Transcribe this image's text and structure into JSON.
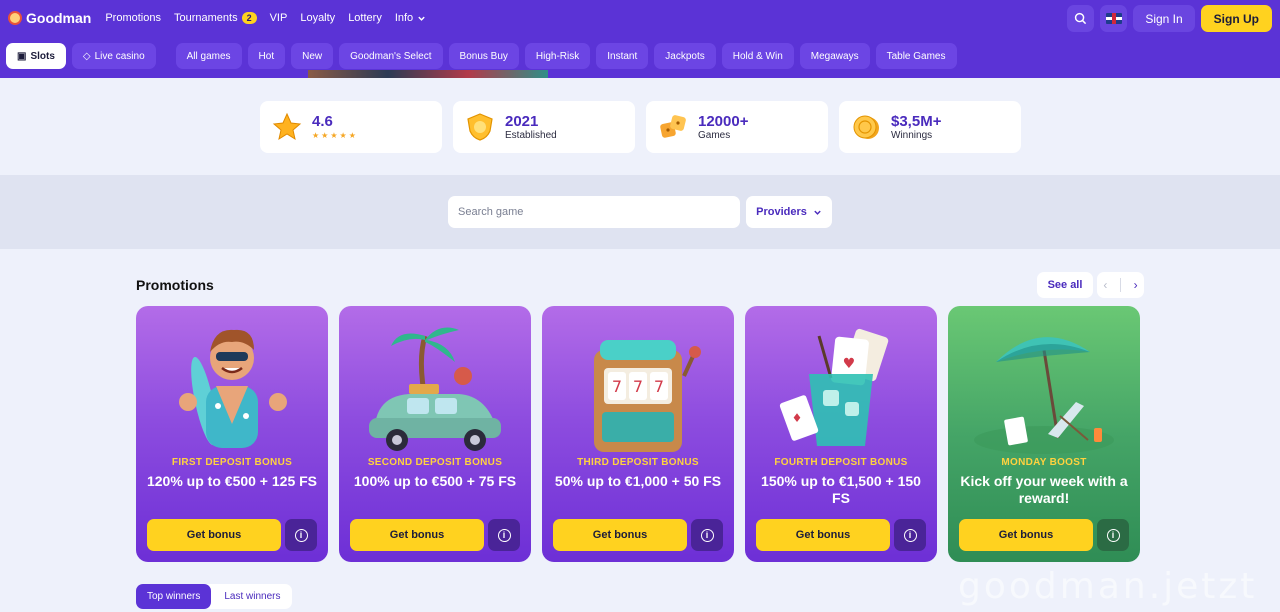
{
  "header": {
    "logo": "Goodman",
    "nav": [
      {
        "label": "Promotions"
      },
      {
        "label": "Tournaments",
        "badge": "2"
      },
      {
        "label": "VIP"
      },
      {
        "label": "Loyalty"
      },
      {
        "label": "Lottery"
      },
      {
        "label": "Info"
      }
    ],
    "signin": "Sign In",
    "signup": "Sign Up",
    "icons": {
      "search": "search-icon",
      "language": "uk-flag-icon"
    }
  },
  "categories": {
    "primary": [
      {
        "label": "Slots",
        "icon": "slot-machine-icon",
        "active": true
      },
      {
        "label": "Live casino",
        "icon": "diamond-icon",
        "active": false
      }
    ],
    "filters": [
      "All games",
      "Hot",
      "New",
      "Goodman's Select",
      "Bonus Buy",
      "High-Risk",
      "Instant",
      "Jackpots",
      "Hold & Win",
      "Megaways",
      "Table Games"
    ]
  },
  "stats": [
    {
      "value": "4.6",
      "label": "",
      "rating": 5,
      "icon": "star-icon"
    },
    {
      "value": "2021",
      "label": "Established",
      "icon": "shield-coin-icon"
    },
    {
      "value": "12000+",
      "label": "Games",
      "icon": "dice-icon"
    },
    {
      "value": "$3,5M+",
      "label": "Winnings",
      "icon": "coin-icon"
    }
  ],
  "search": {
    "placeholder": "Search game",
    "providers": "Providers"
  },
  "promotions": {
    "title": "Promotions",
    "see_all": "See all",
    "cards": [
      {
        "kicker": "FIRST DEPOSIT BONUS",
        "heading": "120% up to €500 + 125 FS",
        "button": "Get bonus",
        "theme": "purple",
        "art": "surfer-man-illustration"
      },
      {
        "kicker": "SECOND DEPOSIT BONUS",
        "heading": "100% up to €500 + 75 FS",
        "button": "Get bonus",
        "theme": "purple",
        "art": "car-palm-illustration"
      },
      {
        "kicker": "THIRD DEPOSIT BONUS",
        "heading": "50% up to €1,000 + 50 FS",
        "button": "Get bonus",
        "theme": "purple",
        "art": "slot-machine-illustration"
      },
      {
        "kicker": "FOURTH DEPOSIT BONUS",
        "heading": "150% up to €1,500 + 150 FS",
        "button": "Get bonus",
        "theme": "purple",
        "art": "cocktail-cards-illustration"
      },
      {
        "kicker": "MONDAY BOOST",
        "heading": "Kick off your week with a reward!",
        "button": "Get bonus",
        "theme": "green",
        "art": "beach-umbrella-illustration"
      }
    ]
  },
  "winners": {
    "tabs": [
      "Top winners",
      "Last winners"
    ],
    "active": 0
  },
  "watermark": "goodman.jetzt",
  "colors": {
    "primary": "#5b33d6",
    "accent": "#ffd21f",
    "card_purple": "#8d4cdf",
    "card_green": "#45a567"
  }
}
